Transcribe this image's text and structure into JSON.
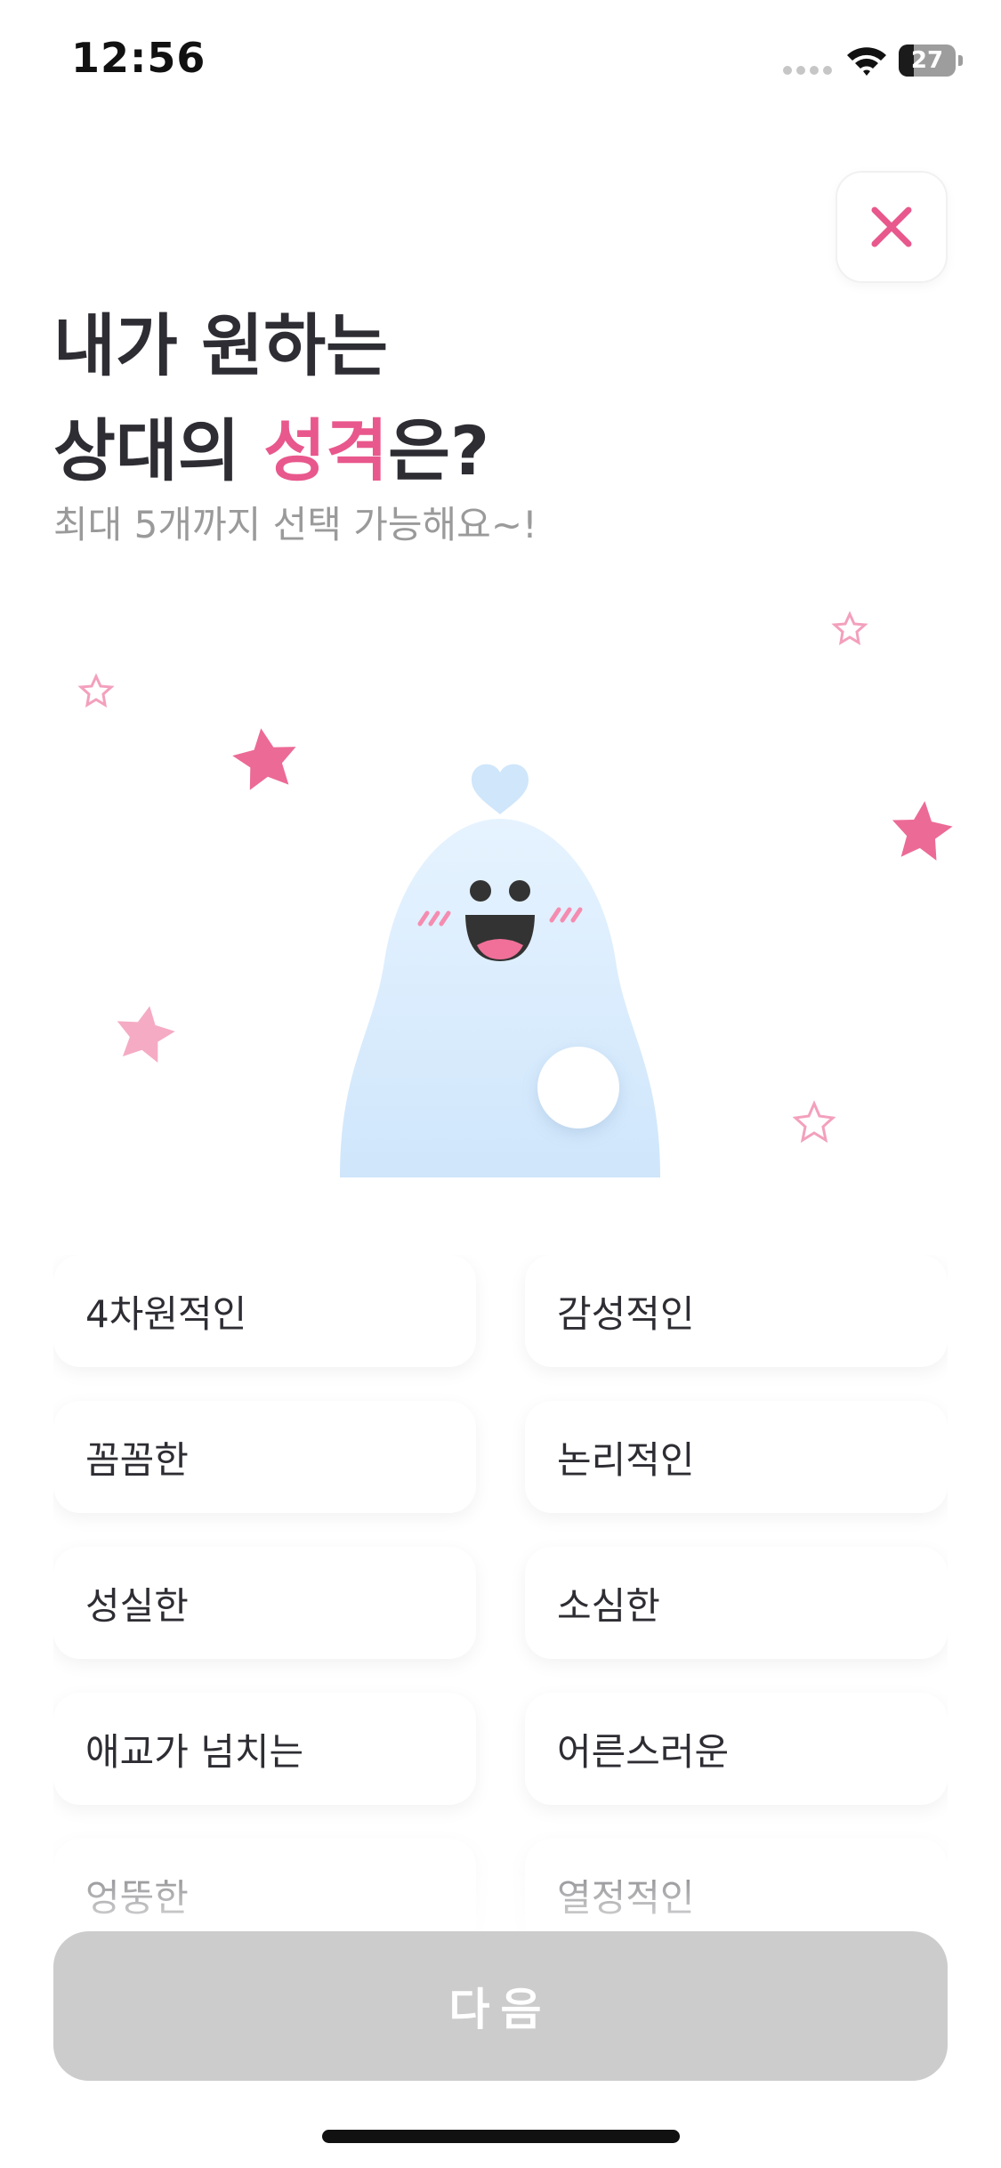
{
  "status_bar": {
    "time": "12:56",
    "battery_level": "27",
    "battery_fraction": 0.27
  },
  "header": {
    "close_icon": "close-icon",
    "title_line1": "내가 원하는",
    "title_line2_before": "상대의 ",
    "title_line2_highlight": "성격",
    "title_line2_after": "은?",
    "subtitle": "최대 5개까지 선택 가능해요~!"
  },
  "options": [
    "4차원적인",
    "감성적인",
    "꼼꼼한",
    "논리적인",
    "성실한",
    "소심한",
    "애교가 넘치는",
    "어른스러운",
    "엉뚱한",
    "열정적인"
  ],
  "next_button_label": "다음",
  "colors": {
    "accent": "#e8588c",
    "title": "#2d2d33",
    "subtitle": "#9a9a9a",
    "button_disabled": "#cccccc",
    "mascot": "#dcefff"
  }
}
